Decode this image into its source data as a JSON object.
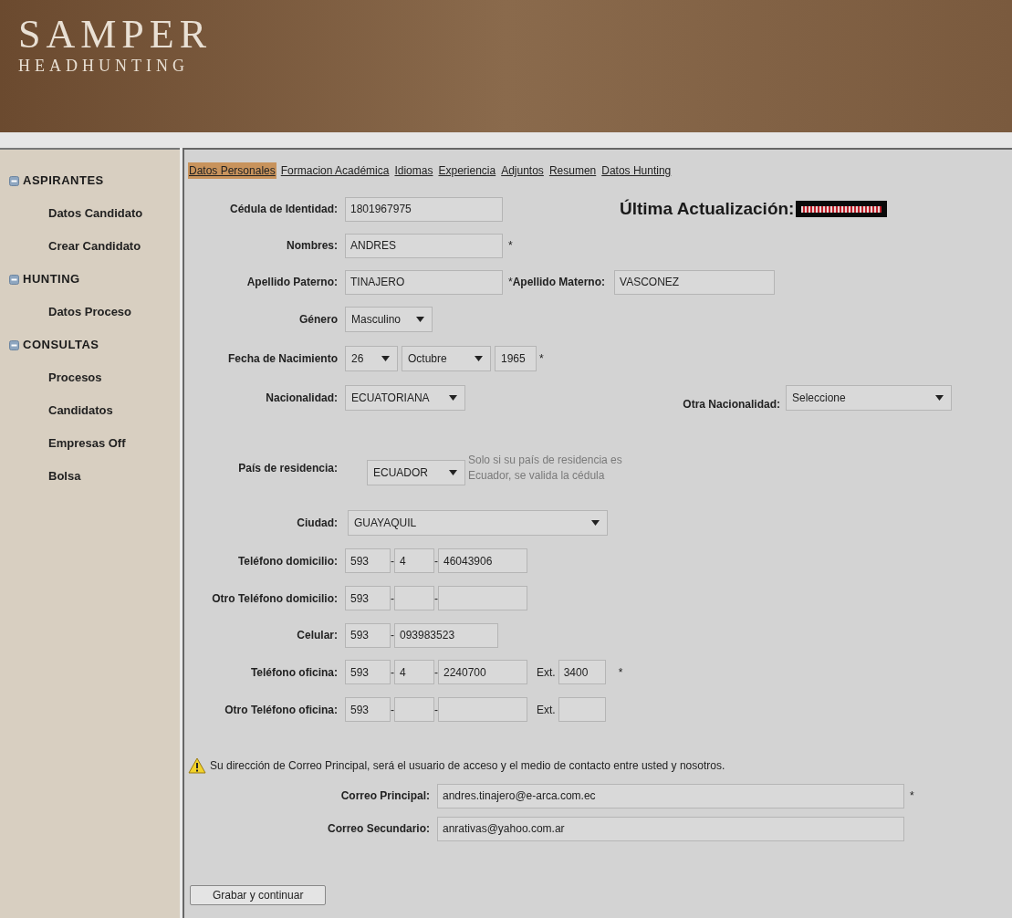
{
  "header": {
    "logo_title": "SAMPER",
    "logo_subtitle": "HEADHUNTING"
  },
  "sidebar": [
    {
      "label": "ASPIRANTES",
      "expanded": true,
      "children": [
        {
          "label": "Datos Candidato"
        },
        {
          "label": "Crear Candidato"
        }
      ]
    },
    {
      "label": "HUNTING",
      "expanded": true,
      "children": [
        {
          "label": "Datos Proceso"
        }
      ]
    },
    {
      "label": "CONSULTAS",
      "expanded": true,
      "children": [
        {
          "label": "Procesos"
        },
        {
          "label": "Candidatos"
        },
        {
          "label": "Empresas Off"
        },
        {
          "label": "Bolsa"
        }
      ]
    }
  ],
  "tabs": [
    {
      "label": "Datos Personales",
      "selected": true
    },
    {
      "label": "Formacion Académica",
      "selected": false
    },
    {
      "label": "Idiomas",
      "selected": false
    },
    {
      "label": "Experiencia",
      "selected": false
    },
    {
      "label": "Adjuntos",
      "selected": false
    },
    {
      "label": "Resumen",
      "selected": false
    },
    {
      "label": "Datos Hunting",
      "selected": false
    }
  ],
  "last_update": {
    "label": "Última Actualización:"
  },
  "rows": [
    {
      "kind": "text",
      "label": "Cédula de Identidad:",
      "value": "1801967975",
      "required": false
    },
    {
      "kind": "text",
      "label": "Nombres:",
      "value": "ANDRES",
      "required": true
    },
    {
      "kind": "text_pair",
      "label": "Apellido Paterno:",
      "value": "TINAJERO",
      "required": true,
      "label_2": "Apellido Materno:",
      "value_2": "VASCONEZ"
    },
    {
      "kind": "select",
      "label": "Género",
      "value": "Masculino"
    },
    {
      "kind": "date",
      "label": "Fecha de Nacimiento",
      "day": "26",
      "month": "Octubre",
      "year": "1965",
      "required": true
    },
    {
      "kind": "select_pair",
      "label": "Nacionalidad:",
      "value": "ECUATORIANA",
      "label_2": "Otra Nacionalidad:",
      "value_2": "Seleccione"
    },
    {
      "kind": "select_note",
      "label": "País de residencia:",
      "value": "ECUADOR",
      "note": "Solo si su país de residencia es Ecuador, se valida la cédula"
    },
    {
      "kind": "city",
      "label": "Ciudad:",
      "value": "GUAYAQUIL"
    },
    {
      "kind": "phone",
      "label": "Teléfono domicilio:",
      "parts": [
        {
          "value": "593"
        },
        {
          "value": "4"
        },
        {
          "value": "46043906"
        }
      ]
    },
    {
      "kind": "phone",
      "label": "Otro Teléfono domicilio:",
      "parts": [
        {
          "value": "593"
        }
      ]
    },
    {
      "kind": "mobile",
      "label": "Celular:",
      "parts": [
        {
          "value": "593"
        },
        {
          "value": "093983523"
        }
      ]
    },
    {
      "kind": "phone",
      "label": "Teléfono oficina:",
      "parts": [
        {
          "value": "593"
        },
        {
          "value": "4"
        },
        {
          "value": "2240700"
        }
      ],
      "ext_label": "Ext.",
      "ext": "3400",
      "required": true
    },
    {
      "kind": "phone",
      "label": "Otro Teléfono oficina:",
      "parts": [
        {
          "value": "593"
        }
      ],
      "ext_label": "Ext."
    }
  ],
  "separator": "-",
  "required_mark": "*",
  "notice": "Su dirección de Correo Principal, será el usuario de acceso y el medio de contacto entre usted y nosotros.",
  "emails": [
    {
      "label": "Correo Principal:",
      "value": "andres.tinajero@e-arca.com.ec",
      "required": true
    },
    {
      "label": "Correo Secundario:",
      "value": "anrativas@yahoo.com.ar",
      "required": false
    }
  ],
  "submit": {
    "label": "Grabar y continuar"
  }
}
